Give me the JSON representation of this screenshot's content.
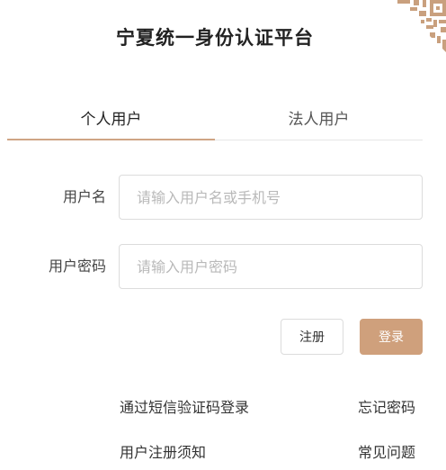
{
  "title": "宁夏统一身份认证平台",
  "tabs": [
    {
      "label": "个人用户",
      "active": true
    },
    {
      "label": "法人用户",
      "active": false
    }
  ],
  "form": {
    "username_label": "用户名",
    "username_placeholder": "请输入用户名或手机号",
    "username_value": "",
    "password_label": "用户密码",
    "password_placeholder": "请输入用户密码",
    "password_value": ""
  },
  "buttons": {
    "register": "注册",
    "login": "登录"
  },
  "links": {
    "sms_login": "通过短信验证码登录",
    "forgot_password": "忘记密码",
    "register_notice": "用户注册须知",
    "faq": "常见问题"
  },
  "colors": {
    "accent": "#cfa07c",
    "tab_underline": "#cfa585",
    "qr": "#c9a07e"
  },
  "icons": {
    "qr_corner": "qr-code-icon"
  }
}
